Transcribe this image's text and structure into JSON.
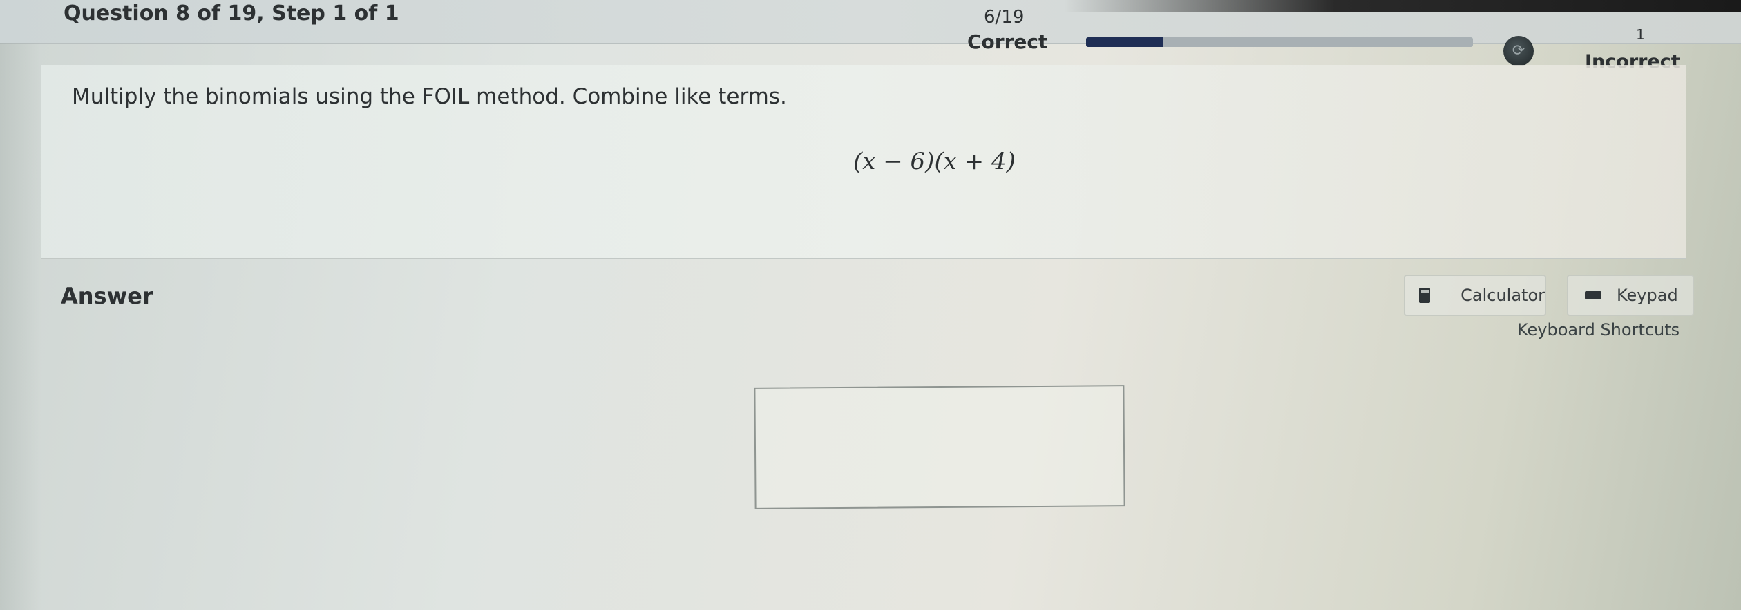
{
  "header": {
    "question_label": "Question 8 of 19,  Step 1 of 1",
    "correct_count": "6/19",
    "correct_label": "Correct",
    "incorrect_count": "1",
    "incorrect_label": "Incorrect",
    "progress_fraction": 0.2,
    "streak_icon": "streak-badge-icon"
  },
  "question": {
    "prompt": "Multiply the binomials using the FOIL method. Combine like terms.",
    "expression": "(x − 6)(x + 4)"
  },
  "answer": {
    "label": "Answer",
    "input_value": ""
  },
  "tools": {
    "calculator_label": "Calculator",
    "calculator_icon": "calculator-icon",
    "keypad_label": "Keypad",
    "keypad_icon": "keypad-icon",
    "shortcuts_label": "Keyboard Shortcuts"
  },
  "colors": {
    "progress_fill": "#1f2e55",
    "progress_track": "#a8b0b4"
  }
}
